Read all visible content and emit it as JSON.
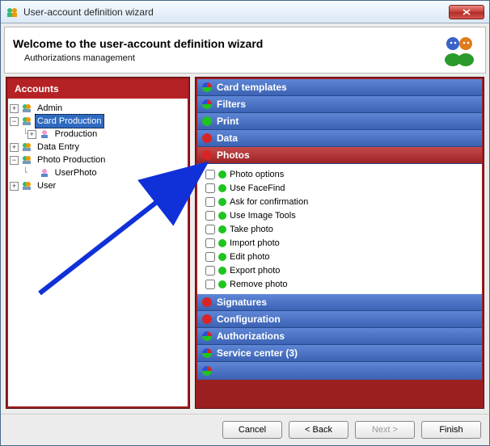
{
  "window": {
    "title": "User-account definition wizard"
  },
  "header": {
    "title": "Welcome to the user-account definition wizard",
    "subtitle": "Authorizations management"
  },
  "accounts": {
    "title": "Accounts",
    "tree": {
      "admin": "Admin",
      "card_production": "Card Production",
      "production": "Production",
      "data_entry": "Data Entry",
      "photo_production": "Photo Production",
      "user_photo": "UserPhoto",
      "user": "User"
    }
  },
  "categories": {
    "card_templates": "Card templates",
    "filters": "Filters",
    "print": "Print",
    "data": "Data",
    "photos": "Photos",
    "signatures": "Signatures",
    "configuration": "Configuration",
    "authorizations": "Authorizations",
    "service_center": "Service center (3)"
  },
  "photo_perms": [
    "Photo options",
    "Use FaceFind",
    "Ask for confirmation",
    "Use Image Tools",
    "Take photo",
    "Import photo",
    "Edit photo",
    "Export photo",
    "Remove photo"
  ],
  "buttons": {
    "cancel": "Cancel",
    "back": "< Back",
    "next": "Next >",
    "finish": "Finish"
  },
  "colors": {
    "red": "#d82424",
    "green": "#1fc41f",
    "blue": "#2b4fd6",
    "tri": "tri"
  }
}
